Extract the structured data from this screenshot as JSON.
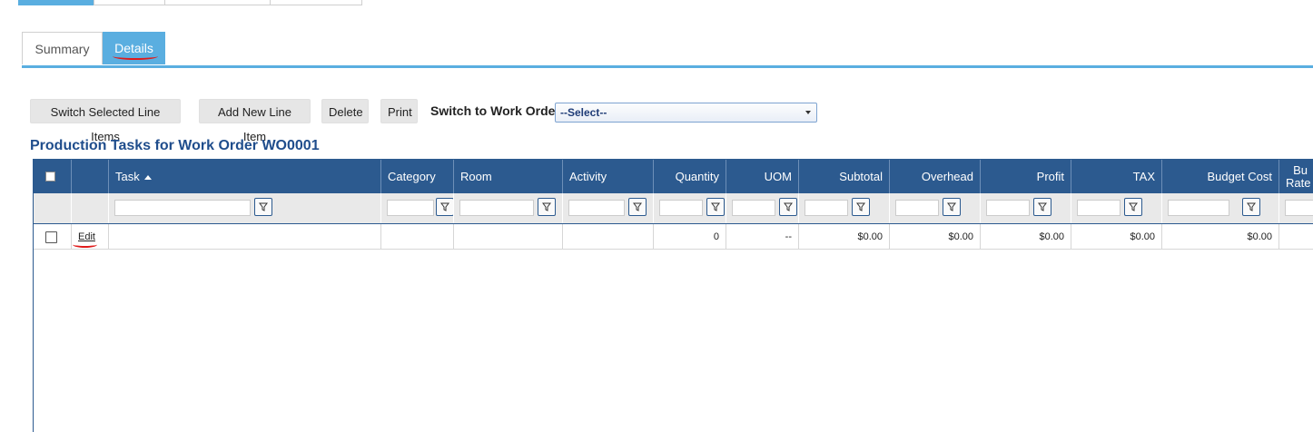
{
  "tabs": [
    {
      "label": "Summary",
      "active": false
    },
    {
      "label": "Details",
      "active": true
    }
  ],
  "toolbar": {
    "switch_selected": "Switch Selected Line Items",
    "add_new": "Add New Line Item",
    "delete": "Delete",
    "print": "Print",
    "switch_label": "Switch to Work Order",
    "select_value": "--Select--"
  },
  "grid": {
    "title": "Production Tasks for Work Order WO0001",
    "columns": [
      "Task",
      "Category",
      "Room",
      "Activity",
      "Quantity",
      "UOM",
      "Subtotal",
      "Overhead",
      "Profit",
      "TAX",
      "Budget Cost",
      "Bu Rate"
    ],
    "sort_column": "Task",
    "rows": [
      {
        "edit": "Edit",
        "task": "",
        "category": "",
        "room": "",
        "activity": "",
        "quantity": "0",
        "uom": "--",
        "subtotal": "$0.00",
        "overhead": "$0.00",
        "profit": "$0.00",
        "tax": "$0.00",
        "budget_cost": "$0.00"
      }
    ]
  },
  "colors": {
    "accent": "#5aaee0",
    "header": "#2c5a8f",
    "title": "#1f4d8c",
    "annotation": "#e01b1b"
  }
}
